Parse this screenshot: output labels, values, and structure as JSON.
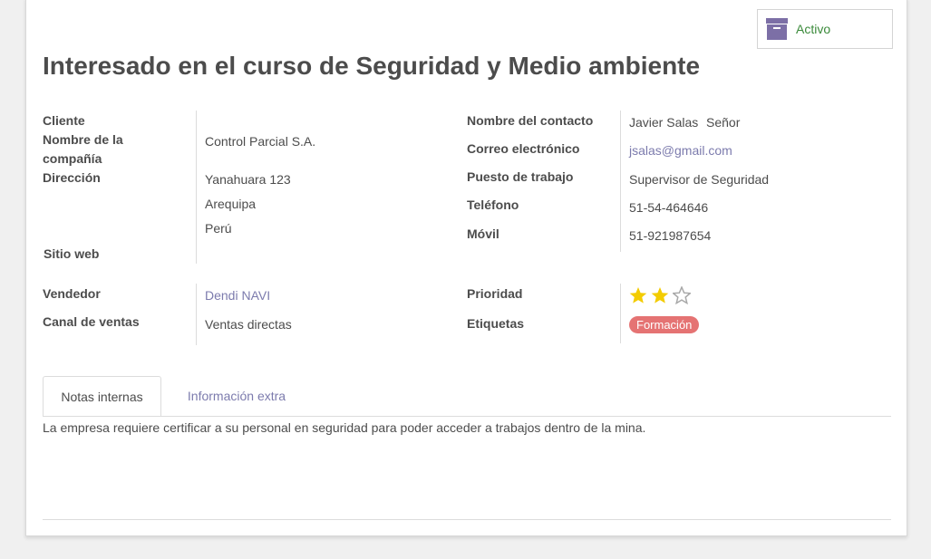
{
  "header": {
    "title": "Interesado en el curso de Seguridad y Medio ambiente",
    "status_button": {
      "label": "Activo",
      "icon": "archive-box-icon",
      "icon_color": "#7c6fa6"
    }
  },
  "left_group": {
    "labels": {
      "customer": "Cliente",
      "company_name": "Nombre de la compañía",
      "address": "Dirección",
      "website": "Sitio web"
    },
    "values": {
      "company_name": "Control Parcial S.A.",
      "street": "Yanahuara 123",
      "city": "Arequipa",
      "country": "Perú"
    }
  },
  "right_group": {
    "labels": {
      "contact_name": "Nombre del contacto",
      "email": "Correo electrónico",
      "job_position": "Puesto de trabajo",
      "phone": "Teléfono",
      "mobile": "Móvil"
    },
    "values": {
      "contact_name": "Javier Salas",
      "title": "Señor",
      "email": "jsalas@gmail.com",
      "job_position": "Supervisor de Seguridad",
      "phone": "51-54-464646",
      "mobile": "51-921987654"
    }
  },
  "sales_group": {
    "labels": {
      "salesperson": "Vendedor",
      "sales_channel": "Canal de ventas"
    },
    "values": {
      "salesperson": "Dendi NAVI",
      "sales_channel": "Ventas directas"
    }
  },
  "priority_group": {
    "labels": {
      "priority": "Prioridad",
      "tags": "Etiquetas"
    },
    "priority": {
      "value": 2,
      "max": 3,
      "filled_color": "#f3cc00",
      "empty_color": "#a8a8a8"
    },
    "tags": [
      {
        "label": "Formación",
        "color": "#e57373"
      }
    ]
  },
  "tabs": [
    {
      "label": "Notas internas",
      "active": true
    },
    {
      "label": "Información extra",
      "active": false
    }
  ],
  "notes": {
    "text": "La empresa requiere certificar a su personal en seguridad para poder acceder a trabajos dentro de la mina."
  },
  "colors": {
    "link": "#7c7bad",
    "text": "#4c4c4c",
    "status_green": "#3a8a3a"
  }
}
